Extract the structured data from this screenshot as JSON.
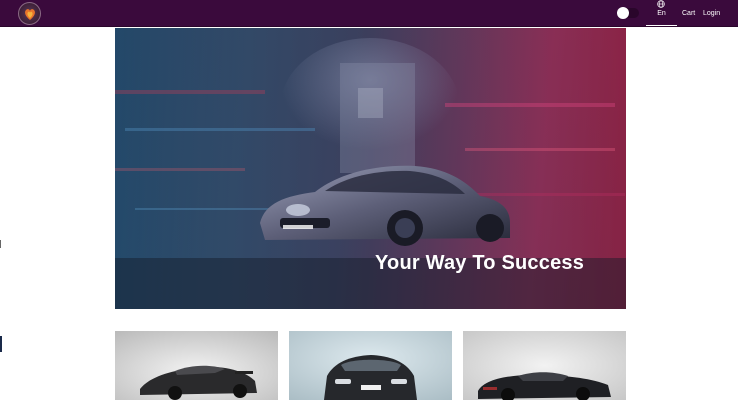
{
  "header": {
    "logo_icon": "flame-heart-logo-icon",
    "theme_toggle": {
      "state": "off",
      "icon": "toggle-icon"
    },
    "language": {
      "icon": "globe-icon",
      "label": "En"
    },
    "cart_label": "Cart",
    "login_label": "Login",
    "colors": {
      "background": "#3a0a3c",
      "text": "#ffffff"
    }
  },
  "hero": {
    "title": "Your Way To Success",
    "image": "sports-car-motion-blur-city"
  },
  "cards": [
    {
      "image": "silver-supercar"
    },
    {
      "image": "black-sports-coupe"
    },
    {
      "image": "black-hypercar"
    }
  ]
}
